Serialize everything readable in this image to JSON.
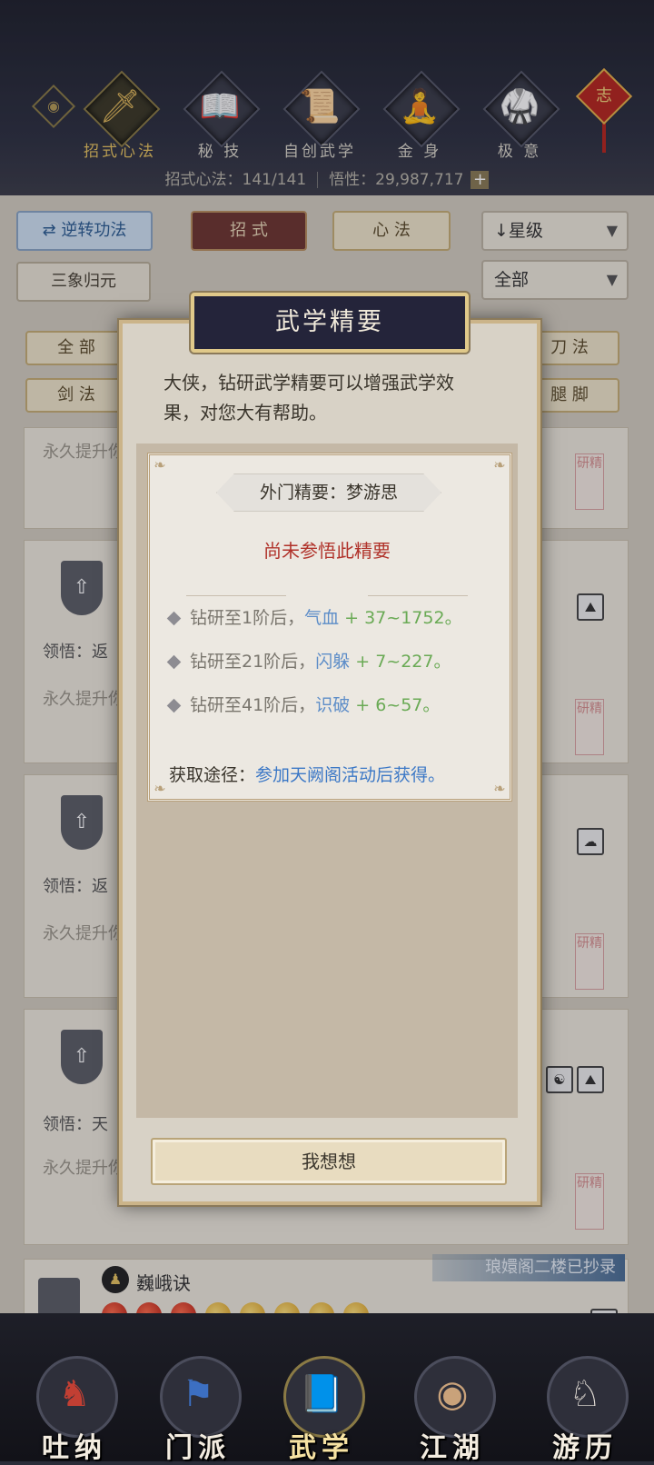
{
  "header": {
    "tabs": [
      {
        "label": "招式心法",
        "icon": "sword-icon",
        "glyph": "🗡",
        "active": true
      },
      {
        "label": "秘 技",
        "icon": "book-icon",
        "glyph": "📖",
        "active": false
      },
      {
        "label": "自创武学",
        "icon": "scroll-icon",
        "glyph": "📜",
        "active": false
      },
      {
        "label": "金 身",
        "icon": "meditation-icon",
        "glyph": "🧘",
        "active": false
      },
      {
        "label": "极 意",
        "icon": "martial-pose-icon",
        "glyph": "🥋",
        "active": false
      }
    ],
    "charm_label": "志",
    "stats_left": "招式心法：141/141",
    "stats_right": "悟性：29,987,717",
    "plus": "+"
  },
  "toolbar": {
    "reverse_label": "逆转功法",
    "tab_moves": "招 式",
    "tab_mind": "心 法",
    "sort_label": "星级",
    "filter_left": "三象归元",
    "filter_all": "全部",
    "cat_all": "全 部",
    "cat_sword": "剑 法",
    "cat_blade": "刀 法",
    "cat_leg": "腿 脚"
  },
  "cards": {
    "perm_text": "永久提升你",
    "comprehend_1": "领悟：返",
    "comprehend_2": "领悟：返",
    "comprehend_3": "领悟：天",
    "last_title": "巍峨诀",
    "last_banner": "琅嬛阁二楼已抄录",
    "seal_text": "研精"
  },
  "modal": {
    "title": "武学精要",
    "intro": "大侠，钻研武学精要可以增强武学效果，对您大有帮助。",
    "tag": "外门精要：梦游思",
    "warning": "尚未参悟此精要",
    "bonuses": [
      {
        "prefix": "钻研至1阶后，",
        "stat": "气血",
        "value": " + 37~1752",
        "suffix": "。"
      },
      {
        "prefix": "钻研至21阶后，",
        "stat": "闪躲",
        "value": " + 7~227",
        "suffix": "。"
      },
      {
        "prefix": "钻研至41阶后，",
        "stat": "识破",
        "value": " + 6~57",
        "suffix": "。"
      }
    ],
    "source_label": "获取途径：",
    "source_value": "参加天阙阁活动后获得。",
    "button": "我想想"
  },
  "nav": {
    "items": [
      {
        "label": "吐纳",
        "active": false
      },
      {
        "label": "门派",
        "active": false
      },
      {
        "label": "武学",
        "active": true
      },
      {
        "label": "江湖",
        "active": false
      },
      {
        "label": "游历",
        "active": false
      }
    ]
  },
  "colors": {
    "accent_gold": "#e6c25f",
    "warning_red": "#b0322a",
    "stat_blue": "#5d8dc8",
    "value_green": "#6aaa55",
    "link_blue": "#3c78c6"
  }
}
